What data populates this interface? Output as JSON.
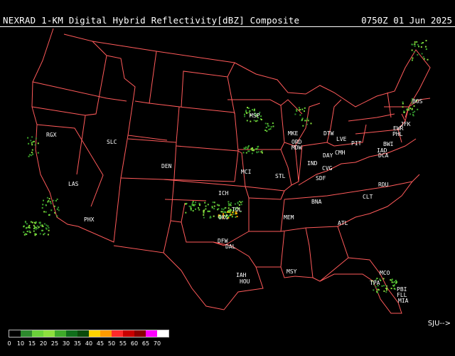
{
  "header": {
    "title": "NEXRAD 1-KM Digital Hybrid Reflectivity[dBZ] Composite",
    "timestamp": "0750Z 01 Jun 2025"
  },
  "colors": {
    "border": "#ff5a5a",
    "site_label": "#ffffff",
    "background": "#000000"
  },
  "sites": [
    "RGX",
    "SLC",
    "DEN",
    "LAS",
    "PHX",
    "MSP",
    "MKE",
    "ORD",
    "MDW",
    "DTW",
    "LVE",
    "PIT",
    "BOS",
    "JFK",
    "EWR",
    "PHL",
    "BWI",
    "IAD",
    "DCA",
    "IND",
    "DAY",
    "CMH",
    "CVG",
    "SDF",
    "STL",
    "MCI",
    "ICH",
    "OKC",
    "TUL",
    "BNA",
    "MEM",
    "RDU",
    "CLT",
    "ATL",
    "DFW",
    "DAL",
    "IAH",
    "HOU",
    "MSY",
    "MCO",
    "TPA",
    "PBI",
    "FLL",
    "MIA"
  ],
  "legend": {
    "dbz_ticks": [
      "0",
      "10",
      "15",
      "20",
      "25",
      "30",
      "35",
      "40",
      "45",
      "50",
      "55",
      "60",
      "65",
      "70"
    ],
    "colors": [
      "#ffffff",
      "#000000",
      "#2d8a2d",
      "#6bd23a",
      "#8ddf3e",
      "#3faa2a",
      "#0f6e1a",
      "#0a4a0a",
      "#ffd400",
      "#ff9a00",
      "#ff2a2a",
      "#c80000",
      "#8a0000",
      "#ff00ff",
      "#ffffff"
    ],
    "sju_label": "SJU-->"
  }
}
